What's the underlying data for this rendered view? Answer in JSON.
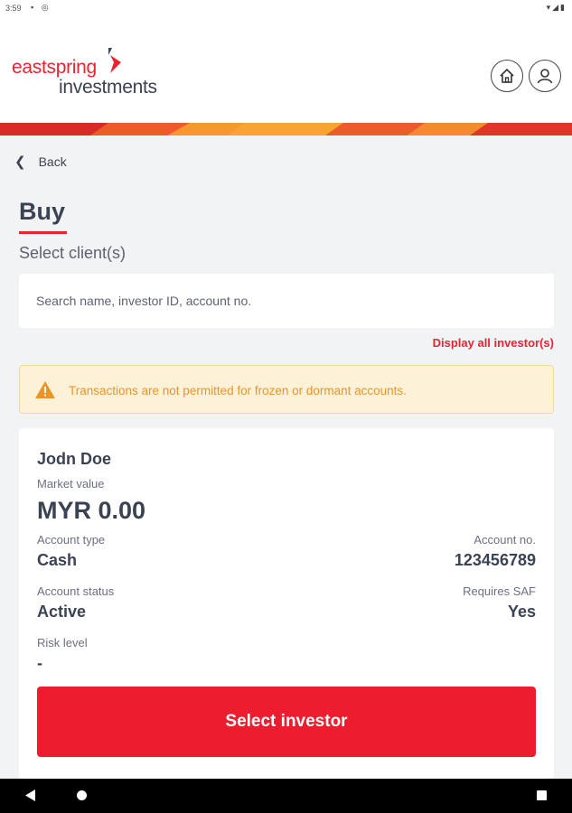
{
  "status_bar": {
    "time": "3:59"
  },
  "logo": {
    "line1": "eastspring",
    "line2": "investments"
  },
  "nav": {
    "back_label": "Back"
  },
  "page": {
    "title": "Buy",
    "subtitle": "Select client(s)"
  },
  "search": {
    "placeholder": "Search name, investor ID, account no."
  },
  "display_all_label": "Display all investor(s)",
  "warning": {
    "text": "Transactions are not permitted for frozen or dormant accounts.",
    "icon": "warning-triangle-icon"
  },
  "investor": {
    "name": "Jodn Doe",
    "market_value_label": "Market value",
    "market_value": "MYR 0.00",
    "account_type_label": "Account type",
    "account_type": "Cash",
    "account_no_label": "Account no.",
    "account_no": "123456789",
    "account_status_label": "Account status",
    "account_status": "Active",
    "requires_saf_label": "Requires SAF",
    "requires_saf": "Yes",
    "risk_level_label": "Risk level",
    "risk_level": "-"
  },
  "select_button_label": "Select investor",
  "colors": {
    "brand_red": "#e8242f",
    "button_red": "#ed1c2e",
    "warning_bg": "#fdf1d8",
    "warning_text": "#e8952a",
    "text_dark": "#3b4252"
  }
}
